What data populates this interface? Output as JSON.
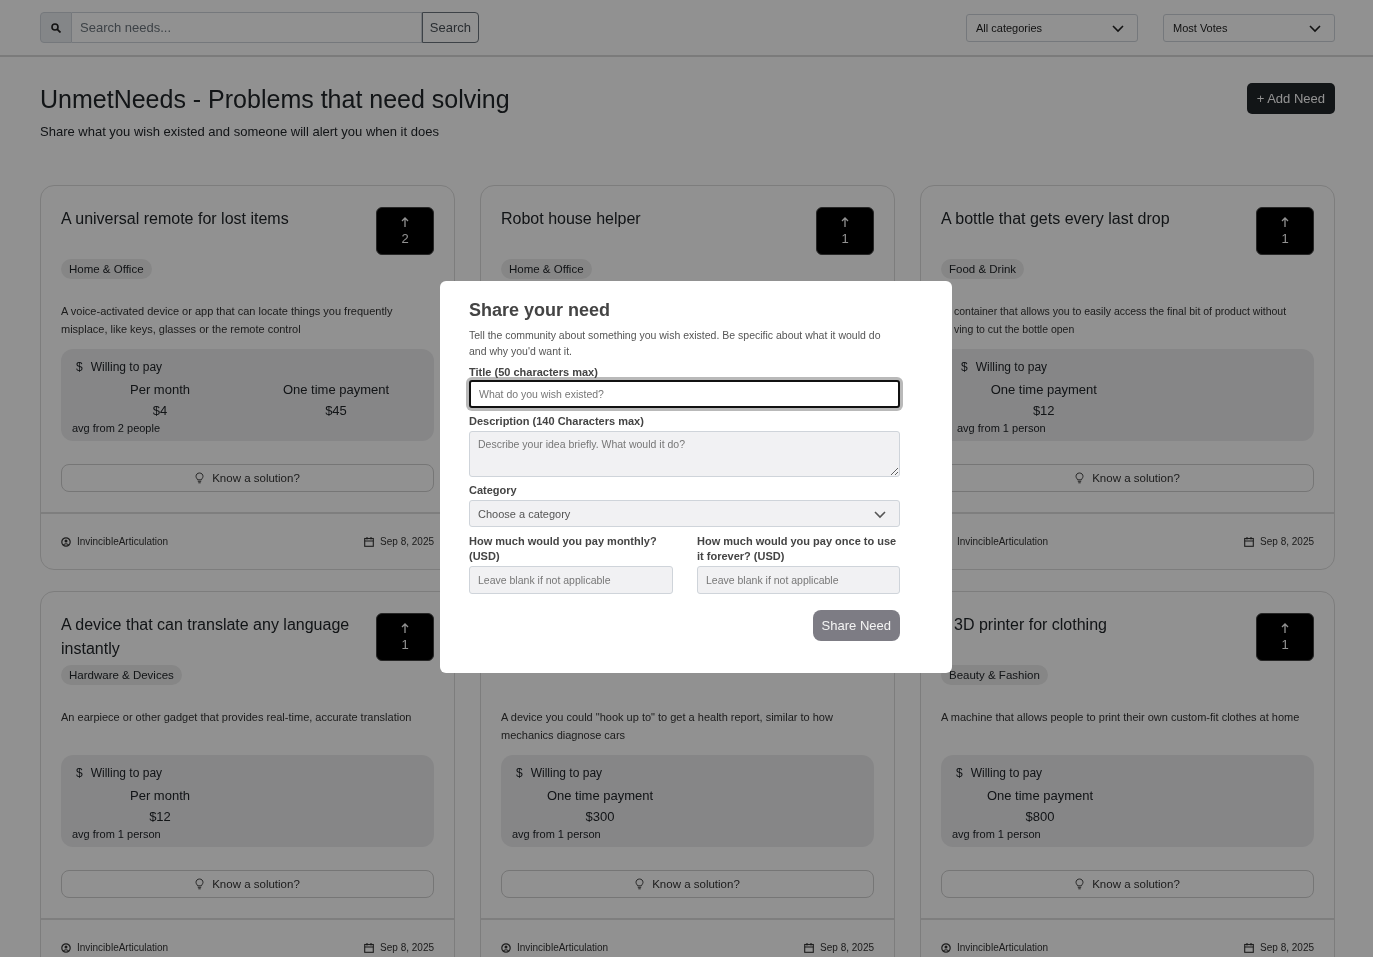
{
  "search": {
    "placeholder": "Search needs...",
    "button": "Search"
  },
  "filters": [
    {
      "value": "All categories"
    },
    {
      "value": "Most Votes"
    }
  ],
  "header": {
    "title": "UnmetNeeds - Problems that need solving",
    "subtitle": "Share what you wish existed and someone will alert you when it does",
    "add_button": "+ Add Need"
  },
  "cards": [
    {
      "kind": "full",
      "title": "A universal remote for lost items",
      "votes": "2",
      "category": "Home & Office",
      "description": "A voice-activated device or app that can locate things you frequently misplace, like keys, glasses or the remote control",
      "pay": {
        "symbol": "$",
        "label": "Willing to pay",
        "columns": [
          {
            "label": "Per month",
            "amount": "$4"
          },
          {
            "label": "One time payment",
            "amount": "$45"
          }
        ],
        "note": "avg from 2 people"
      },
      "solution_button": "Know a solution?",
      "author": "InvincibleArticulation",
      "date": "Sep 8, 2025"
    },
    {
      "kind": "under-modal",
      "title": "Robot house helper",
      "votes": "1",
      "category": "Home & Office"
    },
    {
      "kind": "right-lower",
      "title": "A bottle that gets every last drop",
      "votes": "1",
      "category": "Food & Drink",
      "description": "container that allows you to easily access the final bit of product without\nving to cut the bottle open",
      "pay": {
        "symbol": "$",
        "label": "Willing to pay",
        "columns": [
          {
            "label": "One time payment",
            "amount": "$12"
          }
        ],
        "note": "avg from 1 person"
      },
      "solution_button": "Know a solution?",
      "author": "InvincibleArticulation",
      "date": "Sep 8, 2025"
    },
    {
      "kind": "full",
      "title": "A device that can translate any language instantly",
      "votes": "1",
      "category": "Hardware & Devices",
      "description": "An earpiece or other gadget that provides real-time, accurate translation",
      "pay": {
        "symbol": "$",
        "label": "Willing to pay",
        "columns": [
          {
            "label": "Per month",
            "amount": "$12"
          }
        ],
        "note": "avg from 1 person"
      },
      "solution_button": "Know a solution?",
      "author": "InvincibleArticulation",
      "date": "Sep 8, 2025"
    },
    {
      "kind": "under-modal",
      "description": "A device you could \"hook up to\" to get a health report, similar to how mechanics diagnose cars",
      "pay": {
        "symbol": "$",
        "label": "Willing to pay",
        "columns": [
          {
            "label": "One time payment",
            "amount": "$300"
          }
        ],
        "note": "avg from 1 person"
      },
      "solution_button": "Know a solution?",
      "author": "InvincibleArticulation",
      "date": "Sep 8, 2025"
    },
    {
      "kind": "right-upper",
      "title": "3D printer for clothing",
      "votes": "1",
      "category": "Beauty & Fashion",
      "description": "A machine that allows people to print their own custom-fit clothes at home",
      "pay": {
        "symbol": "$",
        "label": "Willing to pay",
        "columns": [
          {
            "label": "One time payment",
            "amount": "$800"
          }
        ],
        "note": "avg from 1 person"
      },
      "solution_button": "Know a solution?",
      "author": "InvincibleArticulation",
      "date": "Sep 8, 2025"
    }
  ],
  "modal": {
    "title": "Share your need",
    "intro": "Tell the community about something you wish existed. Be specific about what it would do and why you'd want it.",
    "fields": [
      {
        "kind": "input",
        "label": "Title (50 characters max)",
        "placeholder": "What do you wish existed?",
        "focused": true
      },
      {
        "kind": "textarea",
        "label": "Description (140 Characters max)",
        "placeholder": "Describe your idea briefly. What would it do?",
        "focused": false
      },
      {
        "kind": "select",
        "label": "Category",
        "value": "Choose a category",
        "focused": false
      }
    ],
    "price_fields": [
      {
        "label": "How much would you pay monthly? (USD)",
        "placeholder": "Leave blank if not applicable"
      },
      {
        "label": "How much would you pay once to use it forever? (USD)",
        "placeholder": "Leave blank if not applicable"
      }
    ],
    "submit": {
      "label": "Share Need",
      "disabled": true
    }
  }
}
